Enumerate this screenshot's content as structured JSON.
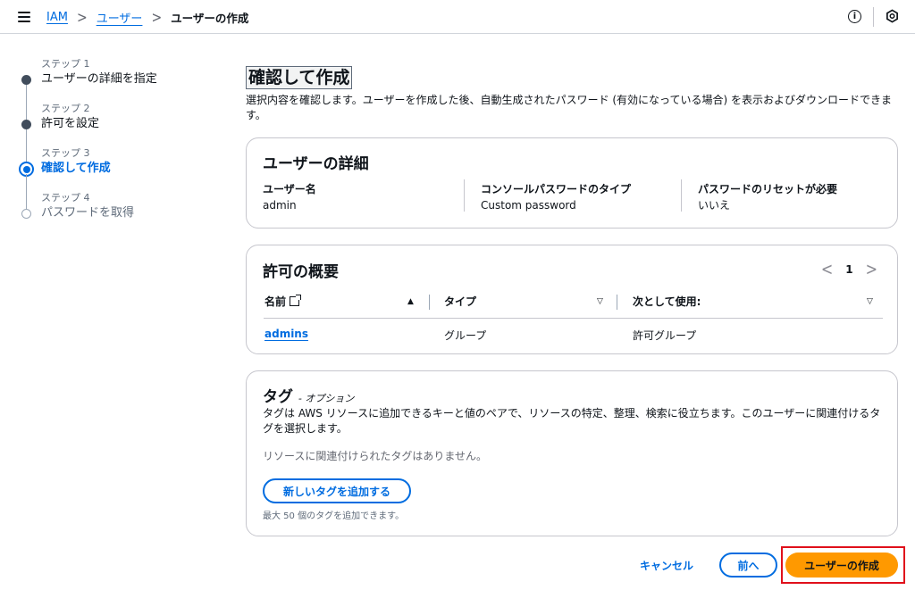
{
  "breadcrumb": {
    "root": "IAM",
    "parent": "ユーザー",
    "current": "ユーザーの作成"
  },
  "header": {
    "info_icon": "info-icon",
    "settings_icon": "hexagon-icon"
  },
  "steps": [
    {
      "num": "ステップ 1",
      "title": "ユーザーの詳細を指定",
      "state": "completed"
    },
    {
      "num": "ステップ 2",
      "title": "許可を設定",
      "state": "completed"
    },
    {
      "num": "ステップ 3",
      "title": "確認して作成",
      "state": "active"
    },
    {
      "num": "ステップ 4",
      "title": "パスワードを取得",
      "state": "pending"
    }
  ],
  "page": {
    "title": "確認して作成",
    "description": "選択内容を確認します。ユーザーを作成した後、自動生成されたパスワード (有効になっている場合) を表示およびダウンロードできます。"
  },
  "user_details": {
    "title": "ユーザーの詳細",
    "fields": [
      {
        "label": "ユーザー名",
        "value": "admin"
      },
      {
        "label": "コンソールパスワードのタイプ",
        "value": "Custom password"
      },
      {
        "label": "パスワードのリセットが必要",
        "value": "いいえ"
      }
    ]
  },
  "permissions": {
    "title": "許可の概要",
    "page": "1",
    "columns": [
      "名前",
      "タイプ",
      "次として使用:"
    ],
    "rows": [
      {
        "name": "admins",
        "type": "グループ",
        "used_as": "許可グループ"
      }
    ]
  },
  "tags": {
    "title": "タグ",
    "optional": "- オプション",
    "description": "タグは AWS リソースに追加できるキーと値のペアで、リソースの特定、整理、検索に役立ちます。このユーザーに関連付けるタグを選択します。",
    "empty": "リソースに関連付けられたタグはありません。",
    "add_button": "新しいタグを追加する",
    "limit": "最大 50 個のタグを追加できます。"
  },
  "footer": {
    "cancel": "キャンセル",
    "previous": "前へ",
    "create": "ユーザーの作成"
  },
  "colors": {
    "link": "#006ce0",
    "primary": "#ff9900",
    "highlight": "#e0101b"
  }
}
